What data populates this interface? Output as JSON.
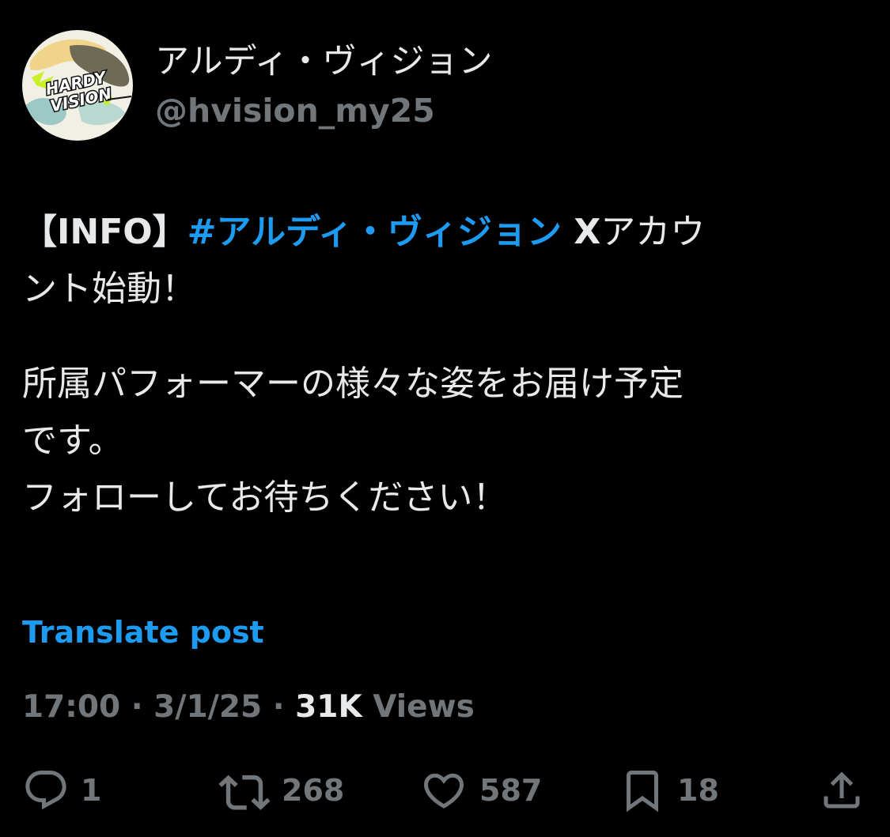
{
  "author": {
    "display_name": "アルディ・ヴィジョン",
    "handle": "@hvision_my25",
    "avatar_logo_text": "HARDY VISION"
  },
  "post": {
    "line1_prefix": "【INFO】",
    "hashtag": "#アルディ・ヴィジョン",
    "line1_after_hashtag_bold": " X",
    "line1_suffix": "アカウ",
    "line2": "ント始動！",
    "line3": "所属パフォーマーの様々な姿をお届け予定",
    "line4": "です。",
    "line5": "フォローしてお待ちください！"
  },
  "translate_label": "Translate post",
  "meta": {
    "time": "17:00",
    "separator": " · ",
    "date": "3/1/25",
    "views_count": "31K",
    "views_label": " Views"
  },
  "actions": {
    "reply": {
      "icon": "reply-icon",
      "count": "1"
    },
    "repost": {
      "icon": "repost-icon",
      "count": "268"
    },
    "like": {
      "icon": "heart-icon",
      "count": "587"
    },
    "bookmark": {
      "icon": "bookmark-icon",
      "count": "18"
    },
    "share": {
      "icon": "share-icon"
    }
  },
  "colors": {
    "background": "#000000",
    "text_primary": "#e7e9ea",
    "text_secondary": "#71767b",
    "link": "#1d9bf0"
  }
}
